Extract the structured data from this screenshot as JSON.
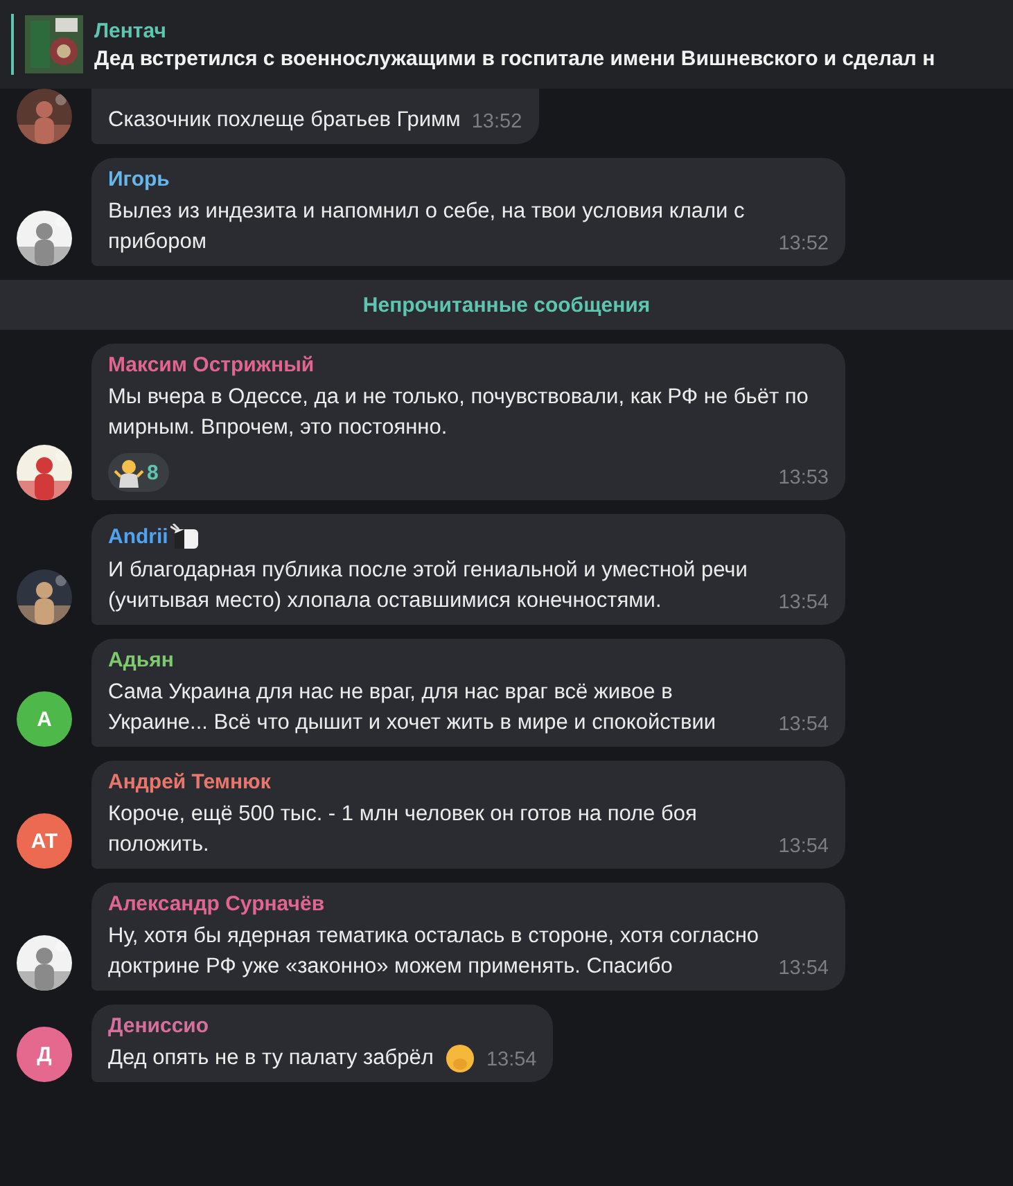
{
  "pinned": {
    "title": "Лентач",
    "text": "Дед встретился с военнослужащими в госпитале имени Вишневского и сделал н"
  },
  "messages": [
    {
      "kind": "message",
      "text": "Сказочник похлеще братьев Гримм",
      "time": "13:52"
    },
    {
      "kind": "message",
      "name": "Игорь",
      "color": "#67b7ea",
      "text": "Вылез из индезита и напомнил о себе, на твои условия клали с прибором",
      "time": "13:52"
    },
    {
      "kind": "divider",
      "text": "Непрочитанные сообщения"
    },
    {
      "kind": "message",
      "name": "Максим Острижный",
      "color": "#e0658f",
      "text": "Мы вчера в Одессе, да и не только, почувствовали, как РФ не бьёт по мирным. Впрочем, это постоянно.",
      "reaction": {
        "count": "8"
      },
      "time": "13:53"
    },
    {
      "kind": "message",
      "name": "Andrii",
      "color": "#4fa3f2",
      "name_badge": true,
      "text": "И благодарная публика после этой гениальной и уместной речи (учитывая место) хлопала оставшимися конечностями.",
      "time": "13:54"
    },
    {
      "kind": "message",
      "name": "Адьян",
      "color": "#7fc96e",
      "avatar": {
        "kind": "letters",
        "letters": "А",
        "color": "#4fb84a"
      },
      "text": "Сама Украина для нас не враг, для нас враг всё живое в Украине... Всё что дышит и хочет жить в мире и спокойствии",
      "time": "13:54"
    },
    {
      "kind": "message",
      "name": "Андрей Темнюк",
      "color": "#e8766a",
      "avatar": {
        "kind": "letters",
        "letters": "АТ",
        "color": "#ec6a52"
      },
      "text": "Короче, ещё 500 тыс. - 1 млн человек он готов на поле боя положить.",
      "time": "13:54"
    },
    {
      "kind": "message",
      "name": "Александр Сурначёв",
      "color": "#e0658f",
      "text": "Ну, хотя бы ядерная тематика осталась в стороне, хотя согласно доктрине РФ уже «законно» можем применять. Спасибо",
      "time": "13:54"
    },
    {
      "kind": "message",
      "name": "Дениссио",
      "color": "#d5709e",
      "avatar": {
        "kind": "letters",
        "letters": "Д",
        "color": "#e5688e"
      },
      "text": "Дед опять не в ту палату забрёл",
      "emoji": true,
      "time": "13:54"
    }
  ]
}
